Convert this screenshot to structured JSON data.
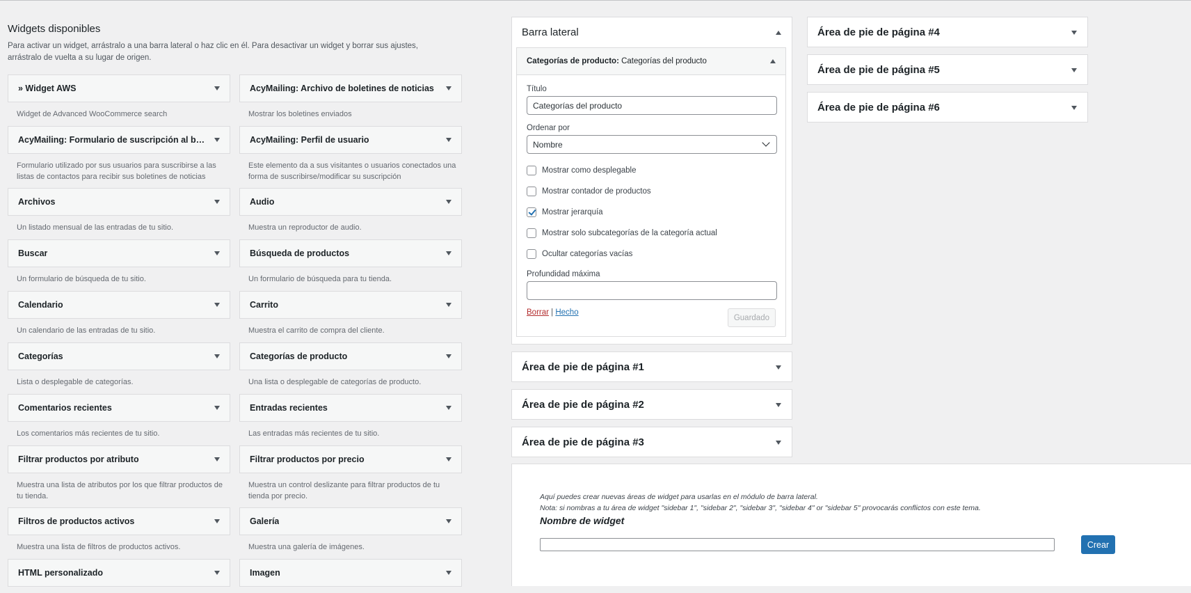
{
  "available": {
    "heading": "Widgets disponibles",
    "intro": "Para activar un widget, arrástralo a una barra lateral o haz clic en él. Para desactivar un widget y borrar sus ajustes, arrástralo de vuelta a su lugar de origen.",
    "widgets": [
      {
        "title": "» Widget AWS",
        "desc": "Widget de Advanced WooCommerce search"
      },
      {
        "title": "AcyMailing: Archivo de boletines de noticias",
        "desc": "Mostrar los boletines enviados"
      },
      {
        "title": "AcyMailing: Formulario de suscripción al bole...",
        "desc": "Formulario utilizado por sus usuarios para suscribirse a las listas de contactos para recibir sus boletines de noticias"
      },
      {
        "title": "AcyMailing: Perfil de usuario",
        "desc": "Este elemento da a sus visitantes o usuarios conectados una forma de suscribirse/modificar su suscripción"
      },
      {
        "title": "Archivos",
        "desc": "Un listado mensual de las entradas de tu sitio."
      },
      {
        "title": "Audio",
        "desc": "Muestra un reproductor de audio."
      },
      {
        "title": "Buscar",
        "desc": "Un formulario de búsqueda de tu sitio."
      },
      {
        "title": "Búsqueda de productos",
        "desc": "Un formulario de búsqueda para tu tienda."
      },
      {
        "title": "Calendario",
        "desc": "Un calendario de las entradas de tu sitio."
      },
      {
        "title": "Carrito",
        "desc": "Muestra el carrito de compra del cliente."
      },
      {
        "title": "Categorías",
        "desc": "Lista o desplegable de categorías."
      },
      {
        "title": "Categorías de producto",
        "desc": "Una lista o desplegable de categorías de producto."
      },
      {
        "title": "Comentarios recientes",
        "desc": "Los comentarios más recientes de tu sitio."
      },
      {
        "title": "Entradas recientes",
        "desc": "Las entradas más recientes de tu sitio."
      },
      {
        "title": "Filtrar productos por atributo",
        "desc": "Muestra una lista de atributos por los que filtrar productos de tu tienda."
      },
      {
        "title": "Filtrar productos por precio",
        "desc": "Muestra un control deslizante para filtrar productos de tu tienda por precio."
      },
      {
        "title": "Filtros de productos activos",
        "desc": "Muestra una lista de filtros de productos activos."
      },
      {
        "title": "Galería",
        "desc": "Muestra una galería de imágenes."
      },
      {
        "title": "HTML personalizado",
        "desc": ""
      },
      {
        "title": "Imagen",
        "desc": ""
      }
    ]
  },
  "sidebar_main": {
    "title": "Barra lateral",
    "widget": {
      "type_label": "Categorías de producto:",
      "instance_title": "Categorías del producto",
      "title_label": "Título",
      "title_value": "Categorías del producto",
      "orderby_label": "Ordenar por",
      "orderby_value": "Nombre",
      "options": [
        {
          "label": "Mostrar como desplegable",
          "checked": false
        },
        {
          "label": "Mostrar contador de productos",
          "checked": false
        },
        {
          "label": "Mostrar jerarquía",
          "checked": true
        },
        {
          "label": "Mostrar solo subcategorías de la categoría actual",
          "checked": false
        },
        {
          "label": "Ocultar categorías vacías",
          "checked": false
        }
      ],
      "depth_label": "Profundidad máxima",
      "depth_value": "",
      "delete_label": "Borrar",
      "separator": "|",
      "done_label": "Hecho",
      "saved_label": "Guardado"
    }
  },
  "footer_areas_col1": [
    "Área de pie de página #1",
    "Área de pie de página #2",
    "Área de pie de página #3"
  ],
  "footer_areas_col2": [
    "Área de pie de página #4",
    "Área de pie de página #5",
    "Área de pie de página #6"
  ],
  "create": {
    "note1": "Aquí puedes crear nuevas áreas de widget para usarlas en el módulo de barra lateral.",
    "note2": "Nota: si nombras a tu área de widget \"sidebar 1\", \"sidebar 2\", \"sidebar 3\", \"sidebar 4\" or \"sidebar 5\" provocarás conflictos con este tema.",
    "name_label": "Nombre de widget",
    "name_value": "",
    "button_label": "Crear"
  },
  "colors": {
    "background": "#f0f0f1",
    "primary_button": "#2271b1",
    "delete_link": "#b32d2e",
    "border": "#dcdcde"
  }
}
